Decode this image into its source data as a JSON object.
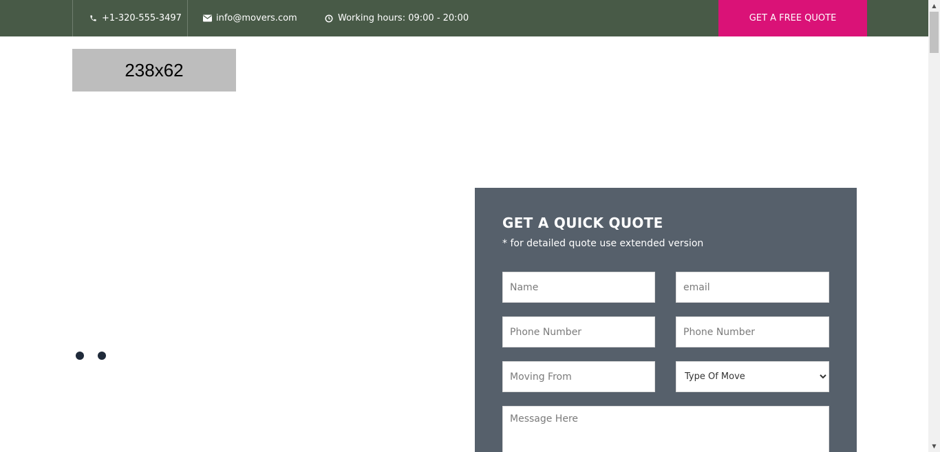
{
  "topbar": {
    "phone": "+1-320-555-3497",
    "email": "info@movers.com",
    "hours": "Working hours: 09:00 - 20:00",
    "quote_button": "GET A FREE QUOTE",
    "phone_icon": "phone-icon",
    "email_icon": "envelope-icon",
    "hours_icon": "clock-icon"
  },
  "logo": {
    "text": "238x62"
  },
  "slider": {
    "dots": 2,
    "active_dot": 1
  },
  "form": {
    "title": "GET A QUICK QUOTE",
    "subtitle": "* for detailed quote use extended version",
    "name_placeholder": "Name",
    "email_placeholder": "email",
    "phone1_placeholder": "Phone Number",
    "phone2_placeholder": "Phone Number",
    "from_placeholder": "Moving From",
    "type_selected": "Type Of Move",
    "message_placeholder": "Message Here"
  },
  "colors": {
    "topbar": "#485a47",
    "accent": "#da1277",
    "form_panel": "#56606b"
  }
}
